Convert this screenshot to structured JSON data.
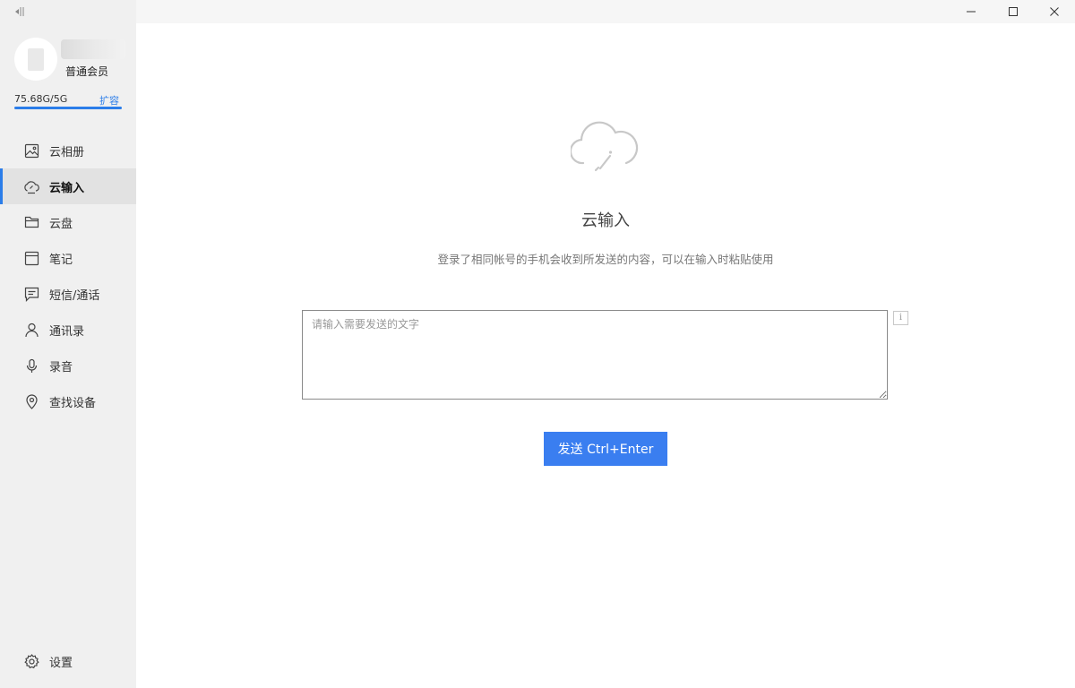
{
  "sidebar": {
    "member_level": "普通会员",
    "storage_text": "75.68G/5G",
    "storage_fill_percent": 100,
    "expand_label": "扩容",
    "items": [
      {
        "label": "云相册",
        "icon": "image-icon"
      },
      {
        "label": "云输入",
        "icon": "cloud-input-icon"
      },
      {
        "label": "云盘",
        "icon": "folder-icon"
      },
      {
        "label": "笔记",
        "icon": "note-icon"
      },
      {
        "label": "短信/通话",
        "icon": "message-icon"
      },
      {
        "label": "通讯录",
        "icon": "contact-icon"
      },
      {
        "label": "录音",
        "icon": "microphone-icon"
      },
      {
        "label": "查找设备",
        "icon": "location-icon"
      }
    ],
    "active_index": 1,
    "settings_label": "设置"
  },
  "main": {
    "title": "云输入",
    "description": "登录了相同帐号的手机会收到所发送的内容，可以在输入时粘贴使用",
    "input_placeholder": "请输入需要发送的文字",
    "input_value": "",
    "info_label": "i",
    "send_label": "发送 Ctrl+Enter"
  },
  "colors": {
    "accent": "#2b7de9",
    "send_button": "#3a7ef0",
    "sidebar_bg": "#f0f0f0"
  }
}
